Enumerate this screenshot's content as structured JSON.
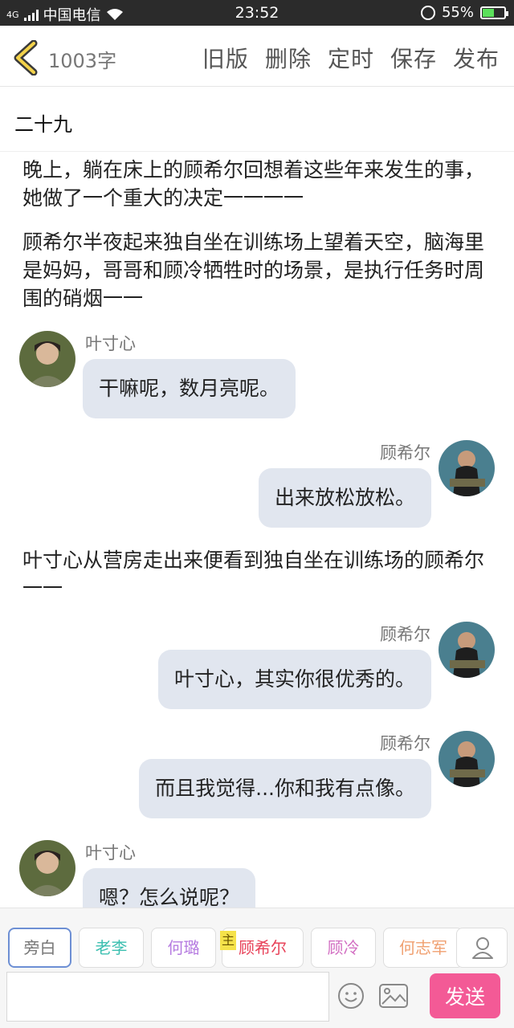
{
  "status_bar": {
    "network": "4G",
    "carrier": "中国电信",
    "time": "23:52",
    "battery": "55%",
    "battery_level": 0.55
  },
  "header": {
    "word_count": "1003字",
    "actions": [
      "旧版",
      "删除",
      "定时",
      "保存",
      "发布"
    ]
  },
  "chapter_title": "二十九",
  "content": {
    "paragraphs": [
      "晚上，躺在床上的顾希尔回想着这些年来发生的事，她做了一个重大的决定一一一一",
      "顾希尔半夜起来独自坐在训练场上望着天空，脑海里是妈妈，哥哥和顾冷牺牲时的场景，是执行任务时周围的硝烟一一",
      "叶寸心从营房走出来便看到独自坐在训练场的顾希尔一一"
    ],
    "messages": [
      {
        "name": "叶寸心",
        "text": "干嘛呢，数月亮呢。"
      },
      {
        "name": "顾希尔",
        "text": "出来放松放松。"
      },
      {
        "name": "顾希尔",
        "text": "叶寸心，其实你很优秀的。"
      },
      {
        "name": "顾希尔",
        "text": "而且我觉得...你和我有点像。"
      },
      {
        "name": "叶寸心",
        "text": "嗯？怎么说呢？"
      }
    ]
  },
  "characters": [
    {
      "label": "旁白",
      "color": "#777777"
    },
    {
      "label": "老李",
      "color": "#3bbfb0"
    },
    {
      "label": "何璐",
      "color": "#b57be0"
    },
    {
      "label": "顾希尔",
      "color": "#e8435a"
    },
    {
      "label": "顾冷",
      "color": "#d26ec2"
    },
    {
      "label": "何志军",
      "color": "#f0a070"
    }
  ],
  "main_badge": "主",
  "input": {
    "value": "",
    "send_label": "发送"
  }
}
